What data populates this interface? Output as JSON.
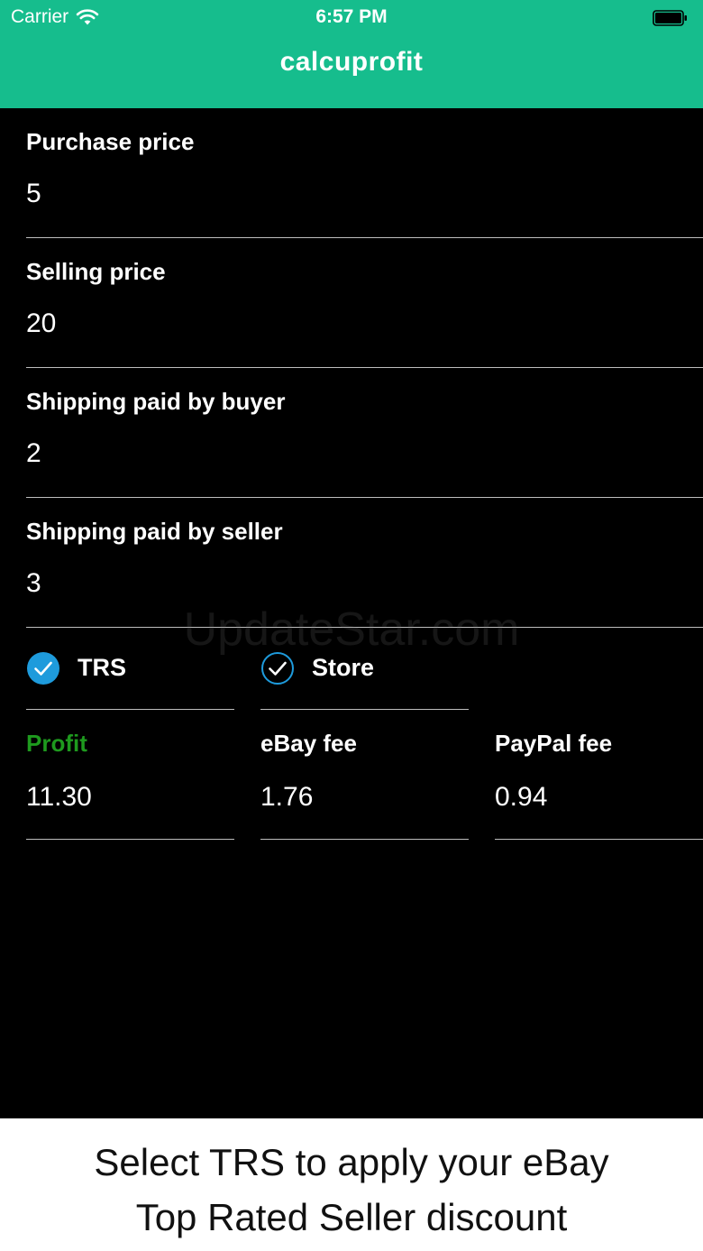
{
  "status_bar": {
    "carrier": "Carrier",
    "time": "6:57 PM"
  },
  "header": {
    "title": "calcuprofit"
  },
  "fields": [
    {
      "label": "Purchase price",
      "value": "5"
    },
    {
      "label": "Selling price",
      "value": "20"
    },
    {
      "label": "Shipping paid by buyer",
      "value": "2"
    },
    {
      "label": "Shipping paid by seller",
      "value": "3"
    }
  ],
  "options": [
    {
      "label": "TRS",
      "checked": true
    },
    {
      "label": "Store",
      "checked": true
    }
  ],
  "results": [
    {
      "label": "Profit",
      "value": "11.30"
    },
    {
      "label": "eBay fee",
      "value": "1.76"
    },
    {
      "label": "PayPal fee",
      "value": "0.94"
    }
  ],
  "watermark": "UpdateStar.com",
  "banner": {
    "line1": "Select TRS to apply your eBay",
    "line2": "Top Rated Seller discount"
  },
  "colors": {
    "header_bg": "#16bd8d",
    "profit_label": "#1e9a1e",
    "check_fill": "#1e9bdc",
    "check_outline": "#1e9bdc"
  },
  "icons": {
    "wifi": "wifi-icon",
    "battery": "battery-icon",
    "check_filled": "check-circle-filled-icon",
    "check_outline": "check-circle-outline-icon"
  }
}
